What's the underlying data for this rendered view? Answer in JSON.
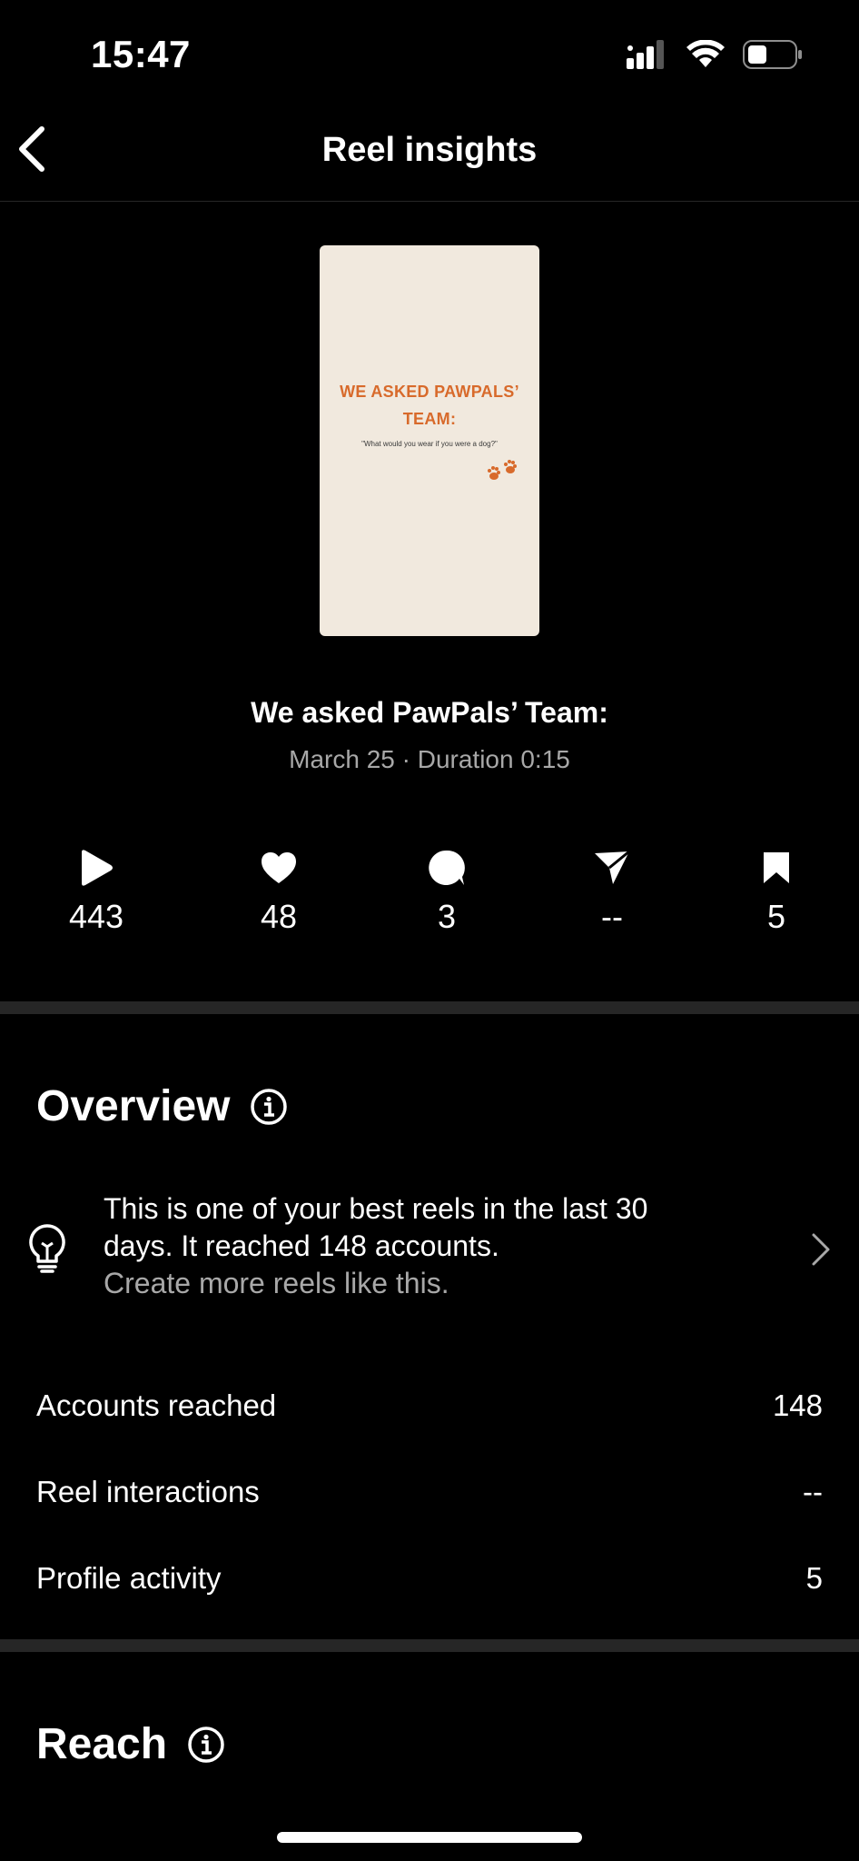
{
  "status_bar": {
    "time": "15:47",
    "icons": [
      "cellular-signal-icon",
      "wifi-icon",
      "battery-icon"
    ]
  },
  "header": {
    "title": "Reel insights",
    "back_icon": "chevron-left-icon"
  },
  "reel": {
    "thumbnail": {
      "title_line1": "WE ASKED PAWPALS’",
      "title_line2": "TEAM:",
      "subtitle": "\"What would you wear if you were a dog?\"",
      "accent_color": "#d86a2b",
      "background_color": "#f1e9de"
    },
    "title": "We asked PawPals’ Team:",
    "meta": "March 25 · Duration 0:15"
  },
  "metrics": [
    {
      "icon": "play-icon",
      "value": "443"
    },
    {
      "icon": "heart-icon",
      "value": "48"
    },
    {
      "icon": "comment-icon",
      "value": "3"
    },
    {
      "icon": "send-icon",
      "value": "--"
    },
    {
      "icon": "bookmark-icon",
      "value": "5"
    }
  ],
  "overview": {
    "title": "Overview",
    "insight": {
      "text_line1": "This is one of your best reels in the last 30",
      "text_line2": "days. It reached 148 accounts.",
      "link": "Create more reels like this."
    },
    "stats": [
      {
        "label": "Accounts reached",
        "value": "148"
      },
      {
        "label": "Reel interactions",
        "value": "--"
      },
      {
        "label": "Profile activity",
        "value": "5"
      }
    ]
  },
  "reach": {
    "title": "Reach"
  }
}
